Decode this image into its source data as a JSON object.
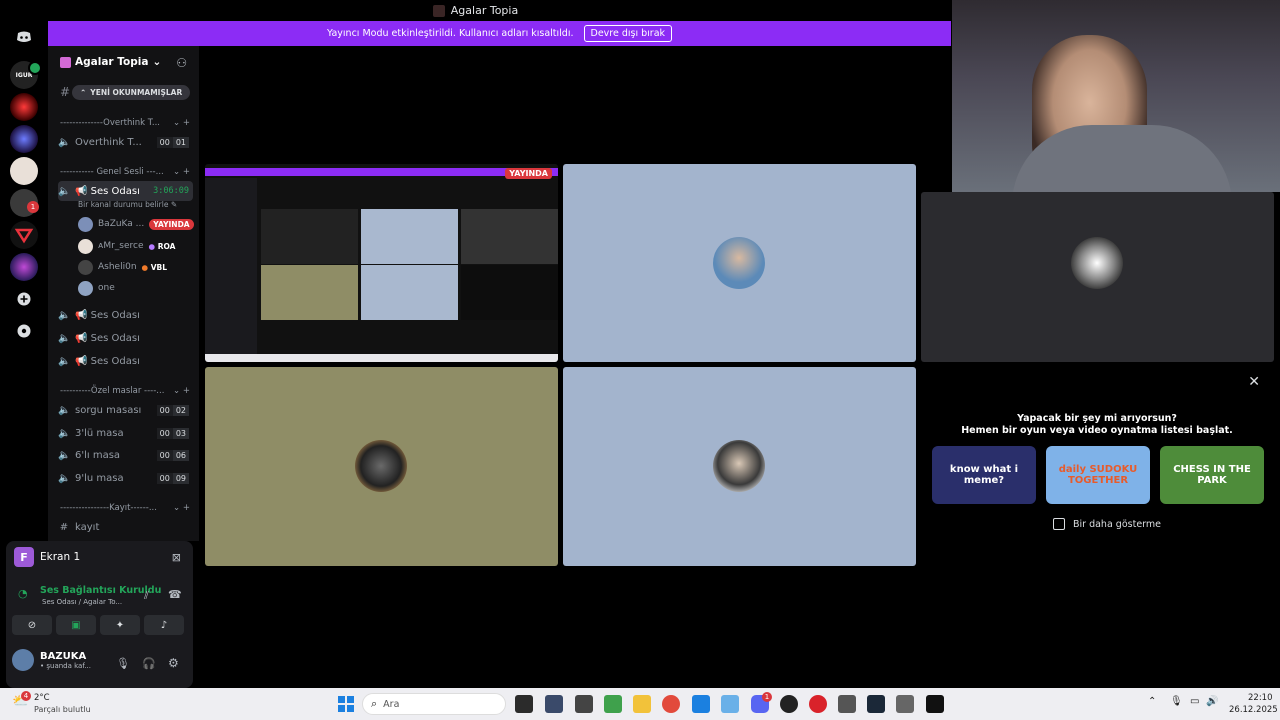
{
  "window": {
    "title": "Agalar Topia"
  },
  "banner": {
    "text": "Yayıncı Modu etkinleştirildi. Kullanıcı adları kısaltıldı.",
    "button": "Devre dışı bırak"
  },
  "colors": {
    "accent": "#8c2cf5",
    "live": "#da373c",
    "connected": "#23a55a"
  },
  "server_list": {
    "mention_badge": "1",
    "icons": [
      "discord-logo-icon",
      "add-server-icon",
      "explore-icon"
    ]
  },
  "sidebar": {
    "server_name": "Agalar Topia",
    "unread_pill": "YENİ OKUNMAMIŞLAR",
    "categories": [
      "--------------Overthink T...",
      "----------- Genel Sesli ---...",
      "----------Özel maslar ----...",
      "----------------Kayıt------..."
    ],
    "channels": [
      {
        "name": "Overthink T...",
        "count": [
          "00",
          "01"
        ]
      },
      {
        "name": "📢 Ses Odası",
        "timer": "3:06:09"
      },
      {
        "name": "📢 Ses Odası"
      },
      {
        "name": "📢 Ses Odası"
      },
      {
        "name": "📢 Ses Odası"
      },
      {
        "name": "sorgu masası",
        "count": [
          "00",
          "02"
        ]
      },
      {
        "name": "3'lü masa",
        "count": [
          "00",
          "03"
        ]
      },
      {
        "name": "6'lı masa",
        "count": [
          "00",
          "06"
        ]
      },
      {
        "name": "9'lu masa",
        "count": [
          "00",
          "09"
        ]
      },
      {
        "name": "kayıt"
      }
    ],
    "status_hint": "Bir kanal durumu belirle",
    "voice_users": [
      {
        "name": "BaZuKa ...",
        "badge": "YAYINDA"
      },
      {
        "name": "ᴀMr_serce",
        "tag": "ROA"
      },
      {
        "name": "Asheli0n",
        "tag": "VBL"
      },
      {
        "name": "one"
      }
    ]
  },
  "panel": {
    "screen_label": "Ekran 1",
    "screen_letter": "F",
    "connection": "Ses Bağlantısı Kuruldu",
    "connection_sub": "Ses Odası / Agalar To...",
    "user_name": "BAZUKA",
    "user_status": "• şuanda kaf..."
  },
  "stream": {
    "live_label": "YAYINDA"
  },
  "suggestion": {
    "line1": "Yapacak bir şey mi arıyorsun?",
    "line2": "Hemen bir oyun veya video oynatma listesi başlat.",
    "cards": [
      {
        "title": "know what i meme?",
        "bg": "#2a2f6b"
      },
      {
        "title": "daily SUDOKU TOGETHER",
        "bg": "#7fb2e8"
      },
      {
        "title": "CHESS IN THE PARK",
        "bg": "#4e8c3a"
      }
    ],
    "checkbox_label": "Bir daha gösterme"
  },
  "taskbar": {
    "weather_temp": "2°C",
    "weather_desc": "Parçalı bulutlu",
    "weather_badge": "4",
    "search_placeholder": "Ara",
    "time": "22:10",
    "date": "26.12.2025",
    "discord_badge": "1"
  }
}
